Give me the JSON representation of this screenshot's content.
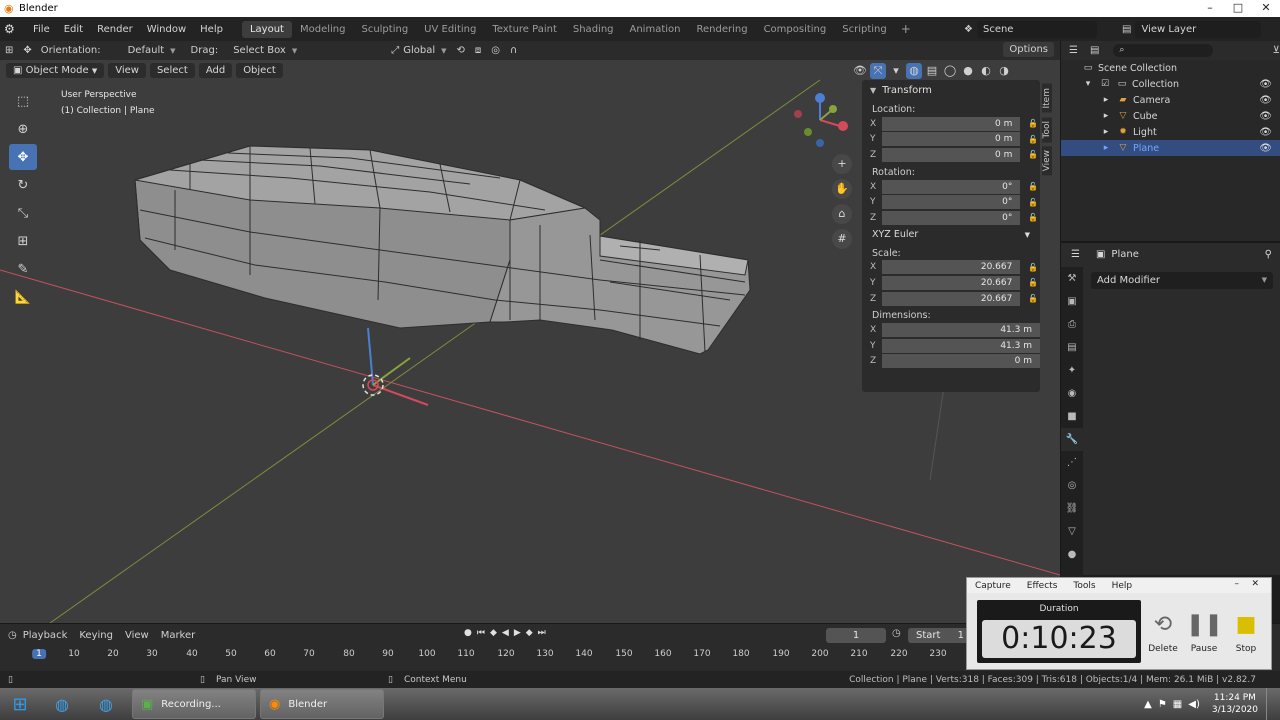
{
  "window": {
    "title": "Blender",
    "controls": [
      "–",
      "□",
      "✕"
    ]
  },
  "topbar": {
    "menus": [
      "File",
      "Edit",
      "Render",
      "Window",
      "Help"
    ],
    "workspaces": [
      "Layout",
      "Modeling",
      "Sculpting",
      "UV Editing",
      "Texture Paint",
      "Shading",
      "Animation",
      "Rendering",
      "Compositing",
      "Scripting"
    ],
    "active_workspace": "Layout",
    "add_workspace": "+",
    "scene": "Scene",
    "view_layer": "View Layer"
  },
  "toolheader": {
    "orientation_label": "Orientation:",
    "orientation_value": "Default",
    "drag_label": "Drag:",
    "drag_value": "Select Box",
    "transform_orientation": "Global",
    "options": "Options"
  },
  "viewport": {
    "mode": "Object Mode",
    "menus": [
      "View",
      "Select",
      "Add",
      "Object"
    ],
    "info_line1": "User Perspective",
    "info_line2": "(1) Collection | Plane",
    "side_tabs": [
      "Item",
      "Tool",
      "View"
    ]
  },
  "npanel": {
    "title": "Transform",
    "location_label": "Location:",
    "location": [
      {
        "axis": "X",
        "value": "0 m"
      },
      {
        "axis": "Y",
        "value": "0 m"
      },
      {
        "axis": "Z",
        "value": "0 m"
      }
    ],
    "rotation_label": "Rotation:",
    "rotation": [
      {
        "axis": "X",
        "value": "0°"
      },
      {
        "axis": "Y",
        "value": "0°"
      },
      {
        "axis": "Z",
        "value": "0°"
      }
    ],
    "rotation_mode": "XYZ Euler",
    "scale_label": "Scale:",
    "scale": [
      {
        "axis": "X",
        "value": "20.667"
      },
      {
        "axis": "Y",
        "value": "20.667"
      },
      {
        "axis": "Z",
        "value": "20.667"
      }
    ],
    "dimensions_label": "Dimensions:",
    "dimensions": [
      {
        "axis": "X",
        "value": "41.3 m"
      },
      {
        "axis": "Y",
        "value": "41.3 m"
      },
      {
        "axis": "Z",
        "value": "0 m"
      }
    ]
  },
  "outliner": {
    "items": [
      {
        "label": "Scene Collection",
        "icon": "scene-collection-icon"
      },
      {
        "label": "Collection",
        "icon": "collection-icon"
      },
      {
        "label": "Camera",
        "icon": "camera-icon"
      },
      {
        "label": "Cube",
        "icon": "mesh-icon"
      },
      {
        "label": "Light",
        "icon": "light-icon"
      },
      {
        "label": "Plane",
        "icon": "mesh-icon",
        "selected": true
      }
    ]
  },
  "properties": {
    "object_name": "Plane",
    "add_modifier": "Add Modifier"
  },
  "timeline": {
    "menus": [
      "Playback",
      "Keying",
      "View",
      "Marker"
    ],
    "current_frame": "1",
    "start_label": "Start",
    "start_value": "1",
    "ruler": [
      "1",
      "10",
      "20",
      "30",
      "40",
      "50",
      "60",
      "70",
      "80",
      "90",
      "100",
      "110",
      "120",
      "130",
      "140",
      "150",
      "160",
      "170",
      "180",
      "190",
      "200",
      "210",
      "220",
      "230"
    ]
  },
  "statusbar": {
    "pan": "Pan View",
    "context": "Context Menu",
    "stats": "Collection | Plane | Verts:318 | Faces:309 | Tris:618 | Objects:1/4 | Mem: 26.1 MiB | v2.82.7"
  },
  "recorder": {
    "menus": [
      "Capture",
      "Effects",
      "Tools",
      "Help"
    ],
    "duration_label": "Duration",
    "time": "0:10:23",
    "buttons": [
      "Delete",
      "Pause",
      "Stop"
    ]
  },
  "taskbar": {
    "apps": [
      "Recording...",
      "Blender"
    ],
    "time": "11:24 PM",
    "date": "3/13/2020"
  },
  "colors": {
    "accent": "#4772b3",
    "x_axis": "#d44a5a",
    "y_axis": "#8aa33a",
    "viewport_bg": "#3d3d3d"
  }
}
